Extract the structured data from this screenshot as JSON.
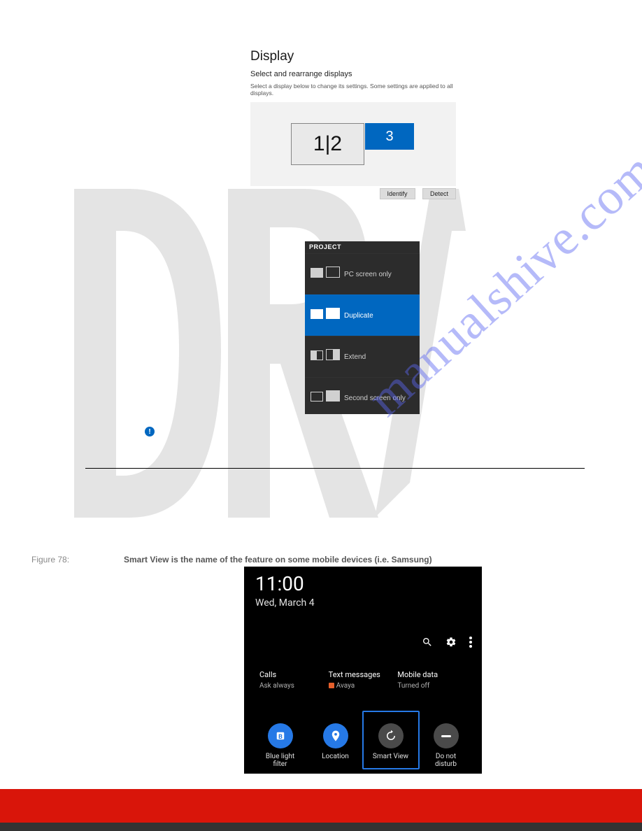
{
  "watermark": {
    "site": "manualshive.com",
    "draft": "DRAFT"
  },
  "display": {
    "title": "Display",
    "section": "Select and rearrange displays",
    "help": "Select a display below to change its settings. Some settings are applied to all displays.",
    "monitor_combined": "1|2",
    "monitor_extra": "3",
    "identify": "Identify",
    "detect": "Detect"
  },
  "project": {
    "header": "PROJECT",
    "items": [
      "PC screen only",
      "Duplicate",
      "Extend",
      "Second screen only"
    ],
    "selected_index": 1
  },
  "note_icon": "!",
  "figure": {
    "label": "Figure 78:",
    "caption": "Smart View is the name of the feature on some mobile devices (i.e. Samsung)"
  },
  "phone": {
    "time": "11:00",
    "date": "Wed, March 4",
    "cols": [
      {
        "title": "Calls",
        "sub": "Ask always"
      },
      {
        "title": "Text messages",
        "sub": "Avaya"
      },
      {
        "title": "Mobile data",
        "sub": "Turned off"
      }
    ],
    "qs": [
      "Blue light filter",
      "Location",
      "Smart View",
      "Do not disturb"
    ]
  }
}
